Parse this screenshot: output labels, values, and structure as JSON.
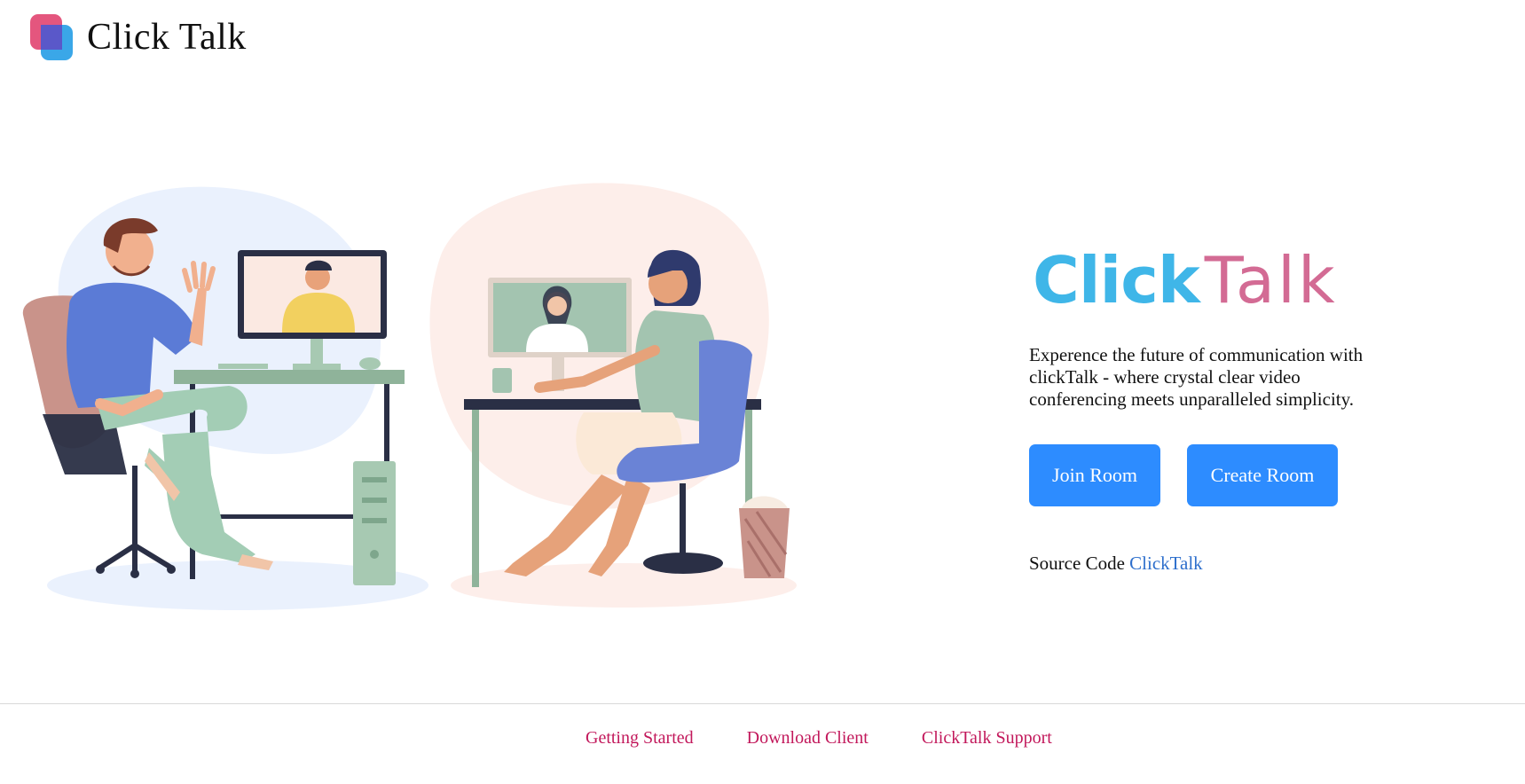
{
  "header": {
    "brand": "Click Talk",
    "logo_icon": "clicktalk-logo-icon"
  },
  "hero": {
    "illustration": "video-call-illustration"
  },
  "intro": {
    "wordmark_click": "Click",
    "wordmark_talk": "Talk",
    "tagline": "Experence the future of communication with clickTalk - where crystal clear video conferencing meets unparalleled simplicity."
  },
  "actions": {
    "join_label": "Join Room",
    "create_label": "Create Room"
  },
  "source": {
    "prefix": "Source Code",
    "link_label": "ClickTalk"
  },
  "footer": {
    "links": [
      "Getting Started",
      "Download Client",
      "ClickTalk Support"
    ]
  },
  "colors": {
    "accent_button": "#2d8cff",
    "wordmark_click": "#3fb6e8",
    "wordmark_talk": "#d36b94",
    "footer_link": "#c2185b"
  }
}
